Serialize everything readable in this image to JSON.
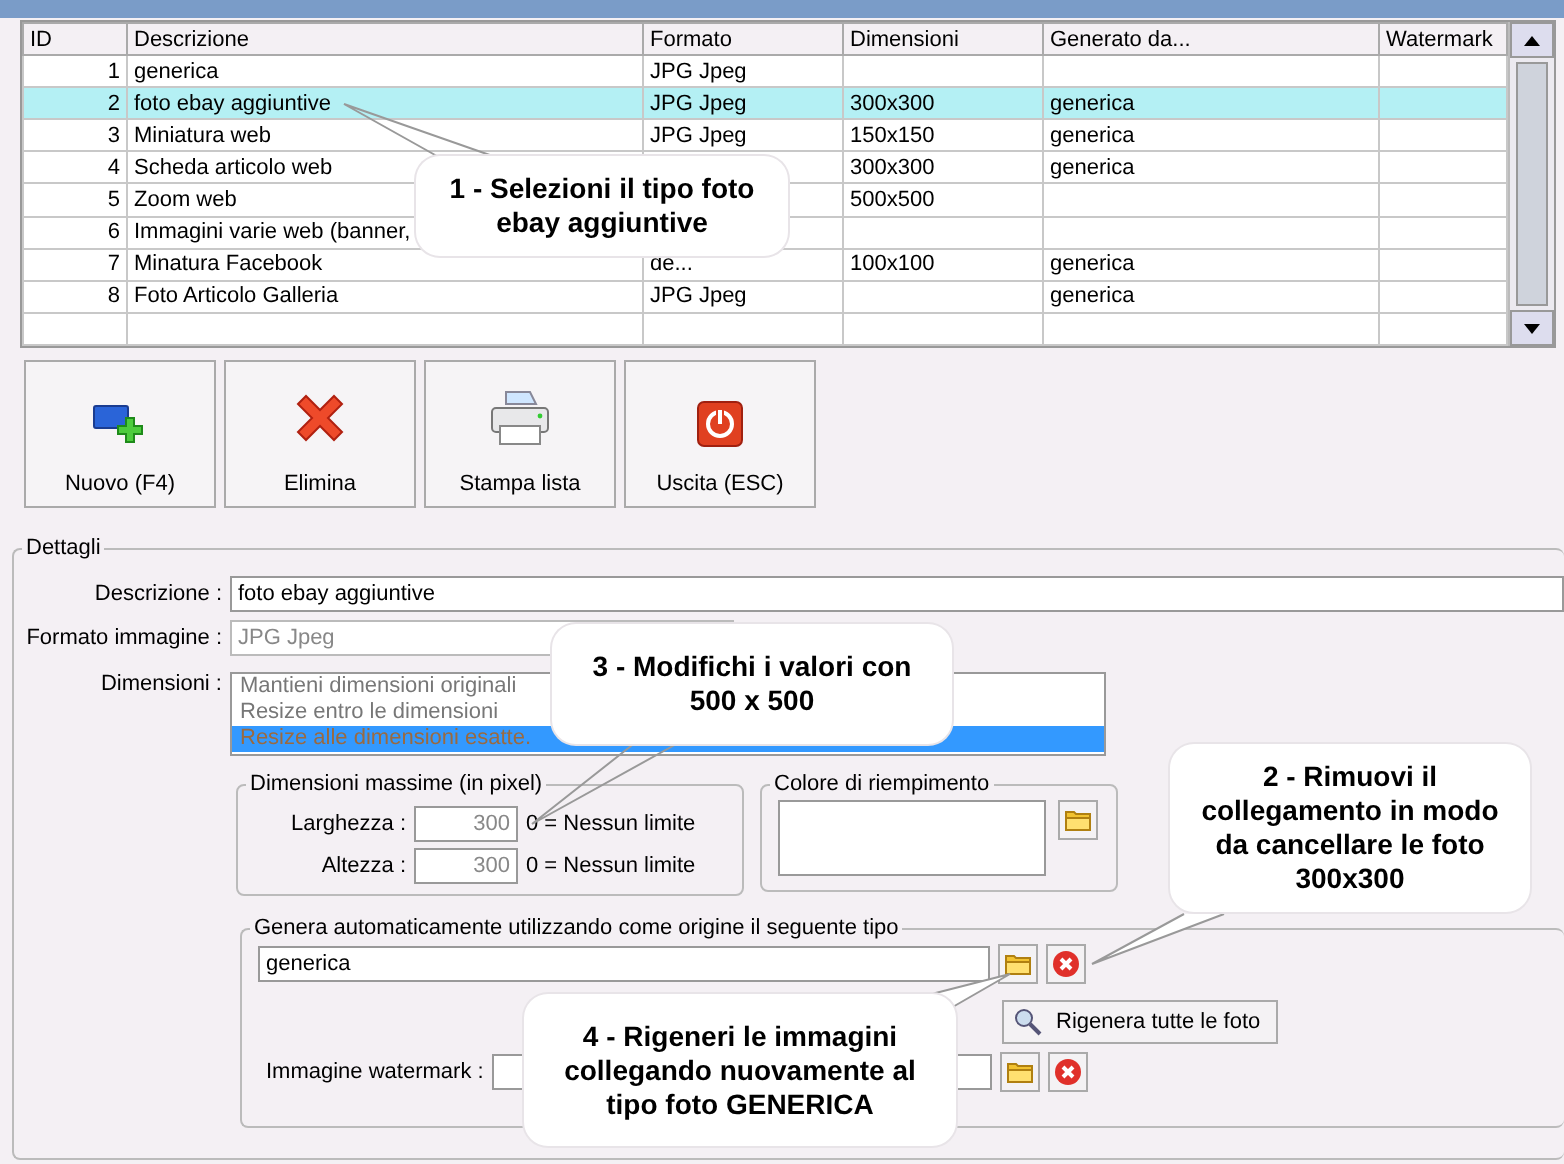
{
  "table": {
    "columns": [
      "ID",
      "Descrizione",
      "Formato",
      "Dimensioni",
      "Generato da...",
      "Watermark"
    ],
    "rows": [
      {
        "id": "1",
        "descrizione": "generica",
        "formato": "JPG Jpeg",
        "dimensioni": "",
        "generato_da": "",
        "selected": false
      },
      {
        "id": "2",
        "descrizione": "foto ebay aggiuntive",
        "formato": "JPG Jpeg",
        "dimensioni": "300x300",
        "generato_da": "generica",
        "selected": true
      },
      {
        "id": "3",
        "descrizione": "Miniatura web",
        "formato": "JPG Jpeg",
        "dimensioni": "150x150",
        "generato_da": "generica",
        "selected": false
      },
      {
        "id": "4",
        "descrizione": "Scheda articolo web",
        "formato": "",
        "dimensioni": "300x300",
        "generato_da": "generica",
        "selected": false
      },
      {
        "id": "5",
        "descrizione": "Zoom web",
        "formato": "",
        "dimensioni": "500x500",
        "generato_da": "",
        "selected": false
      },
      {
        "id": "6",
        "descrizione": "Immagini varie web (banner,",
        "formato": "",
        "dimensioni": "",
        "generato_da": "",
        "selected": false
      },
      {
        "id": "7",
        "descrizione": "Minatura Facebook",
        "formato": "de...",
        "dimensioni": "100x100",
        "generato_da": "generica",
        "selected": false
      },
      {
        "id": "8",
        "descrizione": "Foto Articolo Galleria",
        "formato": "JPG Jpeg",
        "dimensioni": "",
        "generato_da": "generica",
        "selected": false
      }
    ]
  },
  "toolbar": [
    {
      "label": "Nuovo (F4)",
      "kind": "new"
    },
    {
      "label": "Elimina",
      "kind": "delete"
    },
    {
      "label": "Stampa lista",
      "kind": "print"
    },
    {
      "label": "Uscita (ESC)",
      "kind": "exit"
    }
  ],
  "details": {
    "title": "Dettagli",
    "descrizione": {
      "label": "Descrizione :",
      "value": "foto ebay aggiuntive"
    },
    "formato": {
      "label": "Formato immagine :",
      "value": "JPG Jpeg",
      "disabled": true
    },
    "dimensioni": {
      "label": "Dimensioni :",
      "options": [
        {
          "label": "Mantieni dimensioni originali",
          "selected": false
        },
        {
          "label": "Resize entro le dimensioni",
          "selected": false
        },
        {
          "label": "Resize alle dimensioni esatte.",
          "selected": true
        }
      ]
    },
    "max_size": {
      "title": "Dimensioni massime (in pixel)",
      "fields": [
        {
          "label": "Larghezza :",
          "value": "300",
          "hint": "0 = Nessun limite"
        },
        {
          "label": "Altezza :",
          "value": "300",
          "hint": "0 = Nessun limite"
        }
      ]
    },
    "fill_color": {
      "title": "Colore di riempimento"
    },
    "generate": {
      "title": "Genera automaticamente utilizzando come origine il seguente tipo",
      "source": "generica",
      "regen_button": "Rigenera tutte le foto",
      "watermark_label": "Immagine watermark :"
    }
  },
  "callouts": [
    {
      "text": "1 - Selezioni il tipo foto ebay aggiuntive"
    },
    {
      "text": "3 - Modifichi i valori con 500 x 500"
    },
    {
      "text": "2 - Rimuovi il collegamento in modo da cancellare le foto 300x300"
    },
    {
      "text": "4 - Rigeneri le immagini collegando nuovamente al tipo foto GENERICA"
    }
  ]
}
